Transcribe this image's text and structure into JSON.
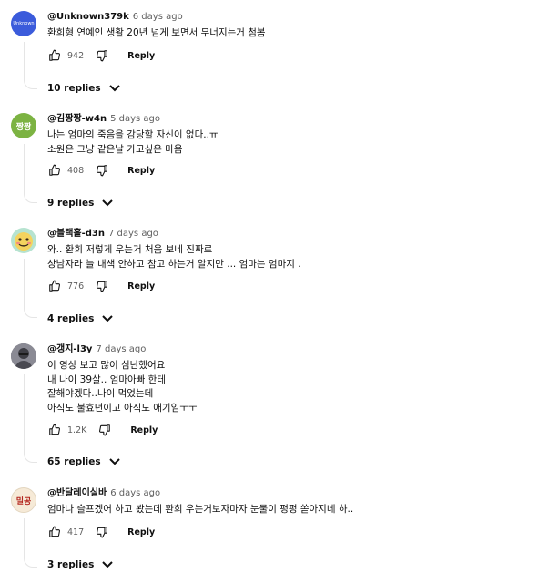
{
  "comments": [
    {
      "author": "@Unknown379k",
      "time": "6 days ago",
      "avatar_text": "Unknown",
      "avatar_color": "#3b5bdb",
      "lines": [
        "환희형 연예인 생활 20년 넘게 보면서 무너지는거 첨봄"
      ],
      "likes": "942",
      "reply_label": "Reply",
      "replies": "10 replies"
    },
    {
      "author": "@김짱짱-w4n",
      "time": "5 days ago",
      "avatar_text": "짱짱",
      "avatar_color": "#7cb342",
      "lines": [
        "나는 엄마의 죽음을 감당할 자신이 없다..ㅠ",
        "소원은 그냥 같은날 가고싶은 마음"
      ],
      "likes": "408",
      "reply_label": "Reply",
      "replies": "9 replies"
    },
    {
      "author": "@블랙홀-d3n",
      "time": "7 days ago",
      "avatar_text": "",
      "avatar_color": "#b6e3d0",
      "lines": [
        "와.. 환희 저렇게 우는거 처음 보네 진짜로",
        "상남자라 늘 내색 안하고 참고 하는거 알지만 ... 엄마는 엄마지 ."
      ],
      "likes": "776",
      "reply_label": "Reply",
      "replies": "4 replies"
    },
    {
      "author": "@갱지-l3y",
      "time": "7 days ago",
      "avatar_text": "",
      "avatar_color": "#6f6f7a",
      "lines": [
        "이 영상 보고 많이 심난했어요",
        "내 나이 39살.. 엄마아빠 한테",
        "잘해야겠다..나이 먹었는데",
        "아직도 불효년이고 아직도 애기임ㅜㅜ"
      ],
      "likes": "1.2K",
      "reply_label": "Reply",
      "replies": "65 replies"
    },
    {
      "author": "@반달레이실바",
      "time": "6 days ago",
      "avatar_text": "밀공",
      "avatar_color": "#f6ead7",
      "lines": [
        "엄마나 슬프겠어 하고 봤는데 환희 우는거보자마자 눈물이 펑펑 쏟아지네 하.."
      ],
      "likes": "417",
      "reply_label": "Reply",
      "replies": "3 replies"
    }
  ]
}
